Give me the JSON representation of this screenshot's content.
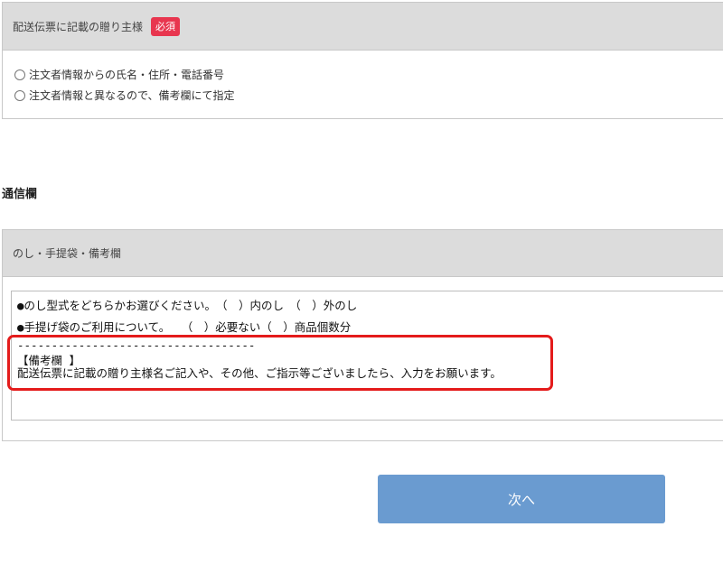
{
  "sender_section": {
    "title": "配送伝票に記載の贈り主様",
    "required_badge": "必須",
    "options": [
      "注文者情報からの氏名・住所・電話番号",
      "注文者情報と異なるので、備考欄にて指定"
    ]
  },
  "communication_section": {
    "label": "通信欄",
    "box_title": "のし・手提袋・備考欄",
    "textarea_lines": [
      "●のし型式をどちらかお選びください。　（　）内のし　（　）外のし",
      "●手提げ袋のご利用について。　　（　）必要ない（　）商品個数分",
      "-----------------------------------",
      "【備考欄 】",
      "配送伝票に記載の贈り主様名ご記入や、その他、ご指示等ございましたら、入力をお願います。"
    ]
  },
  "next_button": {
    "label": "次へ"
  },
  "colors": {
    "required_badge": "#e8364f",
    "highlight_border": "#e41b1b",
    "next_button_bg": "#6a9bd0",
    "header_bg": "#dcdcdc"
  }
}
